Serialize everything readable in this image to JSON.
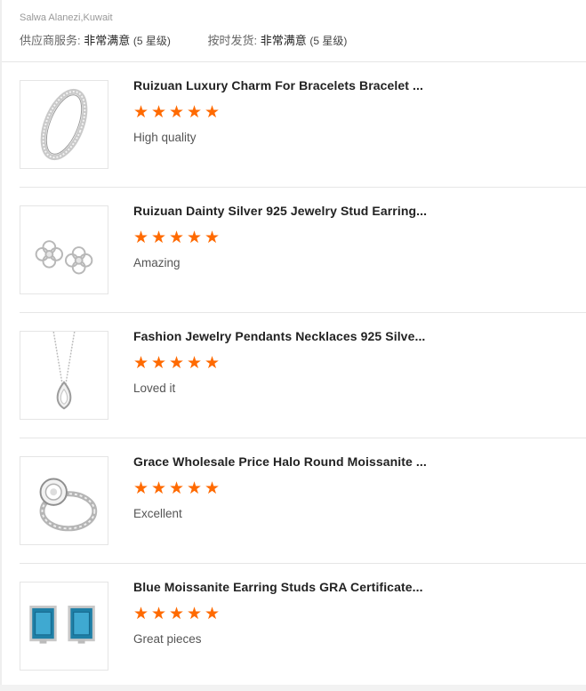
{
  "reviewer": {
    "name_location": "Salwa Alanezi,Kuwait"
  },
  "ratings": {
    "supplier_service_label": "供应商服务:",
    "supplier_service_value": "非常满意",
    "supplier_service_stars": "(5 星级)",
    "on_time_label": "按时发货:",
    "on_time_value": "非常满意",
    "on_time_stars": "(5 星级)"
  },
  "star_color": "#ff6a00",
  "reviews": [
    {
      "title": "Ruizuan Luxury Charm For Bracelets Bracelet ...",
      "rating": 5,
      "comment": "High quality",
      "image_icon": "bangle-bracelet-image"
    },
    {
      "title": "Ruizuan Dainty Silver 925 Jewelry Stud Earring...",
      "rating": 5,
      "comment": "Amazing",
      "image_icon": "flower-stud-earrings-image"
    },
    {
      "title": "Fashion Jewelry Pendants Necklaces 925 Silve...",
      "rating": 5,
      "comment": "Loved it",
      "image_icon": "teardrop-pendant-necklace-image"
    },
    {
      "title": "Grace Wholesale Price Halo Round Moissanite ...",
      "rating": 5,
      "comment": "Excellent",
      "image_icon": "halo-ring-image"
    },
    {
      "title": "Blue Moissanite Earring Studs GRA Certificate...",
      "rating": 5,
      "comment": "Great pieces",
      "image_icon": "blue-emerald-cut-studs-image"
    }
  ]
}
